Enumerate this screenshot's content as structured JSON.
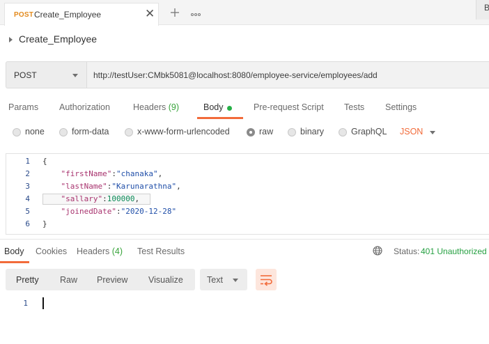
{
  "tab": {
    "method": "POST",
    "name": "Create_Employee",
    "close_icon": "close-icon",
    "add_icon": "plus-icon",
    "more_icon": "ellipsis-icon",
    "right_button_label": "B"
  },
  "request": {
    "title": "Create_Employee",
    "method": "POST",
    "url": "http://testUser:CMbk5081@localhost:8080/employee-service/employees/add"
  },
  "request_tabs": [
    {
      "label": "Params"
    },
    {
      "label": "Authorization"
    },
    {
      "label": "Headers",
      "count": "(9)"
    },
    {
      "label": "Body",
      "active": true
    },
    {
      "label": "Pre-request Script"
    },
    {
      "label": "Tests"
    },
    {
      "label": "Settings"
    }
  ],
  "body_types": [
    {
      "label": "none"
    },
    {
      "label": "form-data"
    },
    {
      "label": "x-www-form-urlencoded"
    },
    {
      "label": "raw",
      "selected": true
    },
    {
      "label": "binary"
    },
    {
      "label": "GraphQL"
    }
  ],
  "format": "JSON",
  "editor": {
    "lines": [
      {
        "n": "1",
        "text": "{"
      },
      {
        "n": "2",
        "key": "\"firstName\"",
        "value": "\"chanaka\"",
        "trail": ","
      },
      {
        "n": "3",
        "key": "\"lastName\"",
        "value": "\"Karunarathna\"",
        "trail": ","
      },
      {
        "n": "4",
        "key": "\"sallary\"",
        "value": "100000",
        "trail": ","
      },
      {
        "n": "5",
        "key": "\"joinedDate\"",
        "value": "\"2020-12-28\"",
        "trail": ""
      },
      {
        "n": "6",
        "text": "}"
      }
    ]
  },
  "response": {
    "tabs": [
      {
        "label": "Body",
        "active": true
      },
      {
        "label": "Cookies"
      },
      {
        "label": "Headers",
        "count": "(4)"
      },
      {
        "label": "Test Results"
      }
    ],
    "status_label": "Status:",
    "status_value": "401 Unauthorized",
    "view_modes": [
      "Pretty",
      "Raw",
      "Preview",
      "Visualize"
    ],
    "text_format": "Text",
    "line_number": "1"
  },
  "colors": {
    "accent": "#f26b3a",
    "post_method": "#e38a1c",
    "status_green": "#26a042"
  }
}
